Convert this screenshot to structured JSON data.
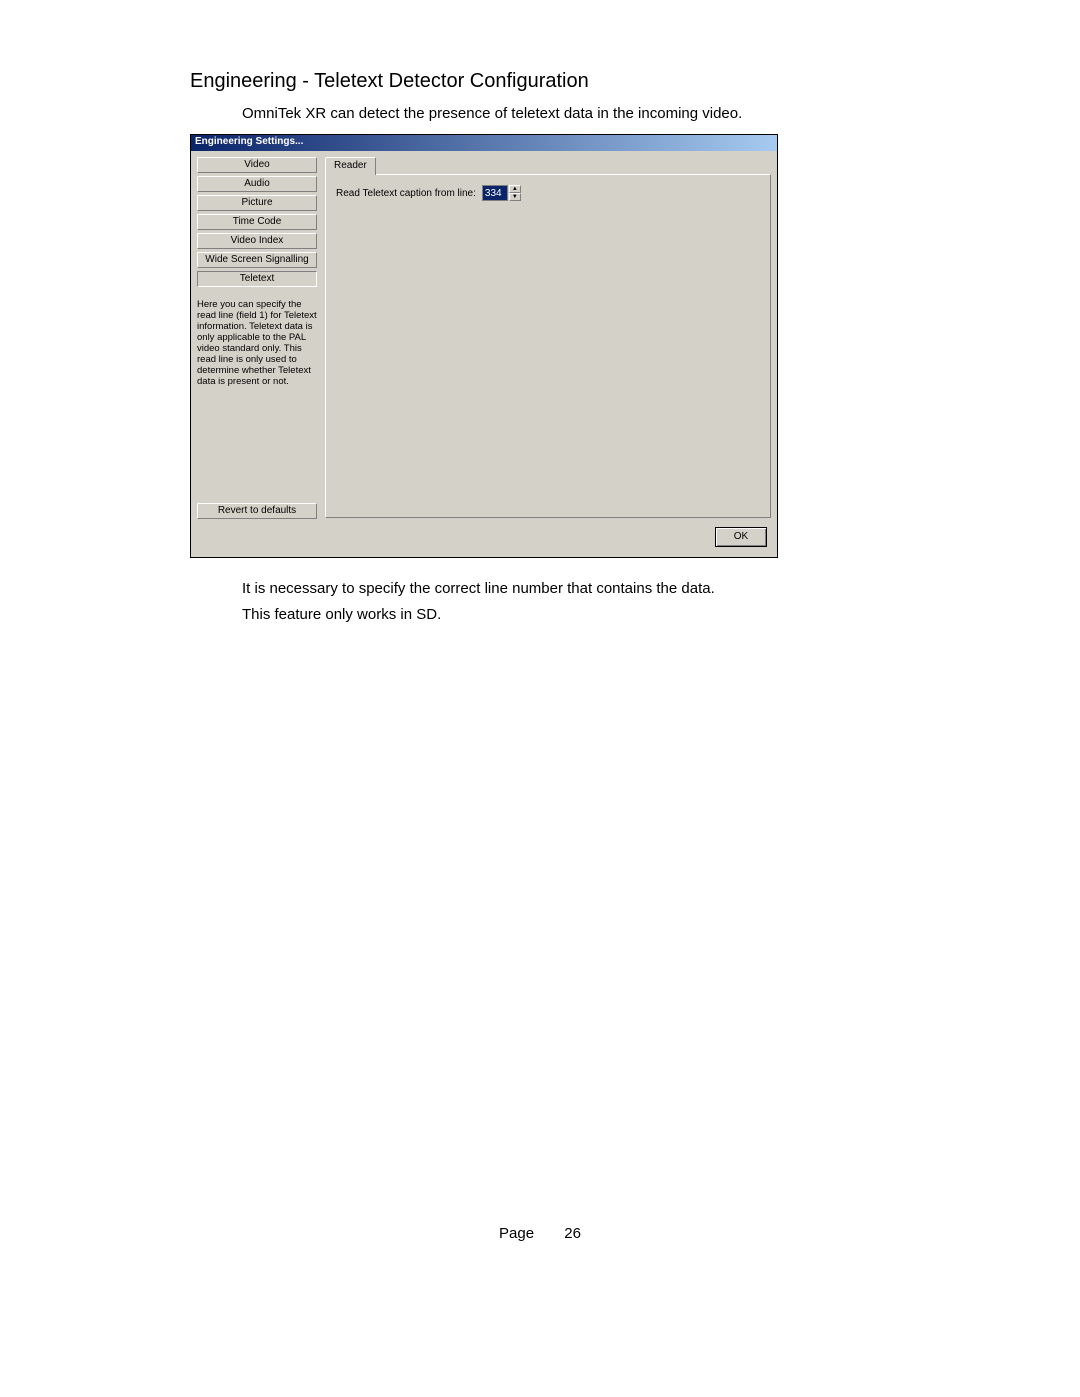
{
  "document": {
    "section_title": "Engineering - Teletext Detector Configuration",
    "intro": "OmniTek XR can detect the presence of teletext data in the incoming video.",
    "after_1": "It is necessary to specify the correct line number that contains the data.",
    "after_2": "This feature only works in SD.",
    "page_label": "Page",
    "page_number": "26"
  },
  "dialog": {
    "title": "Engineering Settings...",
    "sidebar": {
      "items": [
        {
          "label": "Video"
        },
        {
          "label": "Audio"
        },
        {
          "label": "Picture"
        },
        {
          "label": "Time Code"
        },
        {
          "label": "Video Index"
        },
        {
          "label": "Wide Screen Signalling"
        },
        {
          "label": "Teletext"
        }
      ],
      "description": "Here you can specify the read line (field 1) for Teletext information. Teletext data is only applicable to the PAL video standard only. This read line is only used to determine whether Teletext data is present or not.",
      "revert": "Revert to defaults"
    },
    "tab": {
      "label": "Reader",
      "field_label": "Read Teletext caption from line:",
      "value": "334"
    },
    "ok": "OK"
  }
}
